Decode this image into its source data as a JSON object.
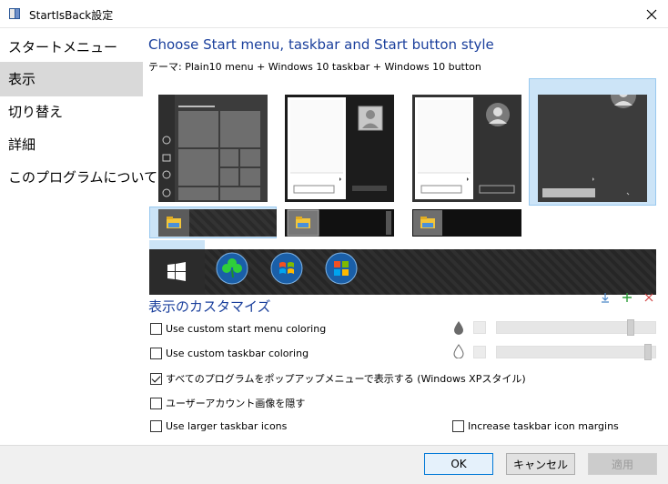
{
  "window": {
    "title": "StartIsBack設定"
  },
  "sidebar": {
    "items": [
      {
        "label": "スタートメニュー"
      },
      {
        "label": "表示"
      },
      {
        "label": "切り替え"
      },
      {
        "label": "詳細"
      },
      {
        "label": "このプログラムについて"
      }
    ]
  },
  "main": {
    "heading": "Choose Start menu, taskbar and Start button style",
    "theme_line": "テーマ:  Plain10 menu + Windows 10 taskbar + Windows 10 button",
    "customize_heading": "表示のカスタマイズ",
    "options": {
      "custom_start_menu_coloring": "Use custom start menu coloring",
      "custom_taskbar_coloring": "Use custom taskbar coloring",
      "all_programs_popup": "すべてのプログラムをポップアップメニューで表示する (Windows XPスタイル)",
      "hide_user_picture": "ユーザーアカウント画像を隠す",
      "larger_taskbar_icons": "Use larger taskbar icons",
      "increase_margins": "Increase taskbar icon margins"
    },
    "sliders": {
      "start_menu_opacity": 0.86,
      "taskbar_opacity": 0.97
    }
  },
  "footer": {
    "ok": "OK",
    "cancel": "キャンセル",
    "apply": "適用"
  },
  "colors": {
    "accent": "#1a3f9c",
    "selection": "#cce4f7"
  }
}
